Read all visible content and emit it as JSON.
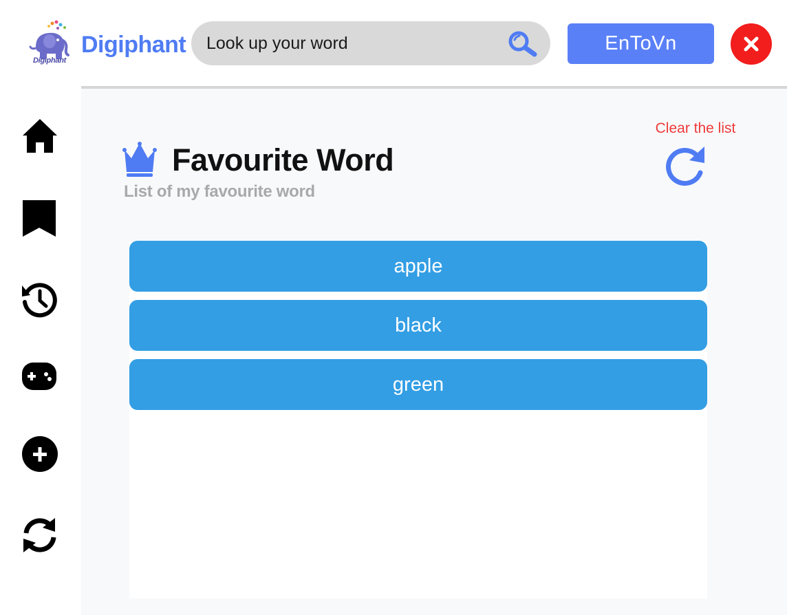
{
  "header": {
    "brand_name": "Digiphant",
    "logo_caption": "Digiphant",
    "search": {
      "placeholder": "Look up your word",
      "value": ""
    },
    "language_button_label": "EnToVn"
  },
  "sidebar": {
    "items": [
      {
        "icon": "home-icon"
      },
      {
        "icon": "bookmark-icon"
      },
      {
        "icon": "history-icon"
      },
      {
        "icon": "gamepad-icon"
      },
      {
        "icon": "add-circle-icon"
      },
      {
        "icon": "sync-icon"
      }
    ]
  },
  "main": {
    "title": "Favourite Word",
    "subtitle": "List of my favourite word",
    "clear_label": "Clear the list",
    "words": [
      "apple",
      "black",
      "green"
    ]
  },
  "colors": {
    "brand": "#4f7cf3",
    "language_button": "#5a80f7",
    "close_button": "#f21d1d",
    "word_item": "#339ee4",
    "clear_label": "#ee3a3a",
    "crown": "#4f7cf3"
  }
}
